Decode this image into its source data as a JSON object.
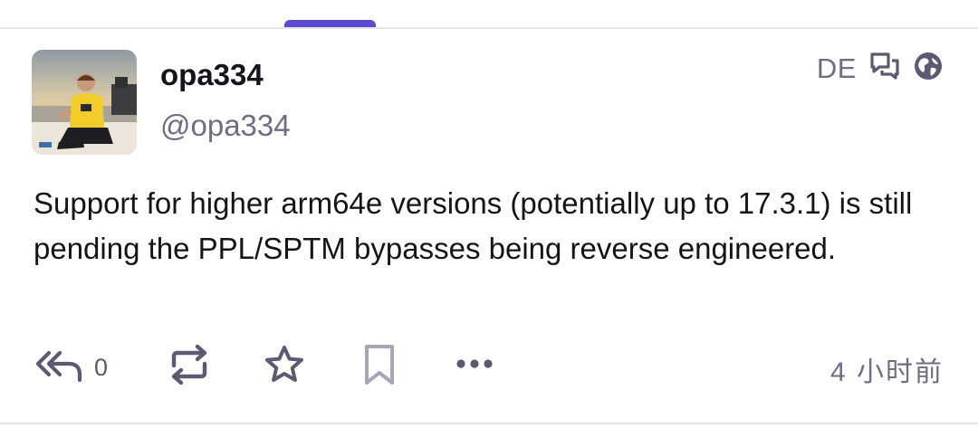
{
  "post": {
    "display_name": "opa334",
    "handle": "@opa334",
    "language": "DE",
    "text": "Support for higher arm64e versions (potentially up to 17.3.1) is still pending the PPL/SPTM bypasses being reverse engineered.",
    "reply_count": "0",
    "timestamp": "4 小时前"
  },
  "icons": {
    "context": "conversation-icon",
    "visibility": "globe-icon",
    "reply": "reply-all-icon",
    "boost": "boost-icon",
    "favourite": "star-icon",
    "bookmark": "bookmark-icon",
    "more": "more-icon"
  },
  "colors": {
    "accent": "#5a4bd1",
    "text": "#15141a",
    "muted": "#6f6c86",
    "icon": "#5c5a72",
    "divider": "#e4e4ea"
  }
}
